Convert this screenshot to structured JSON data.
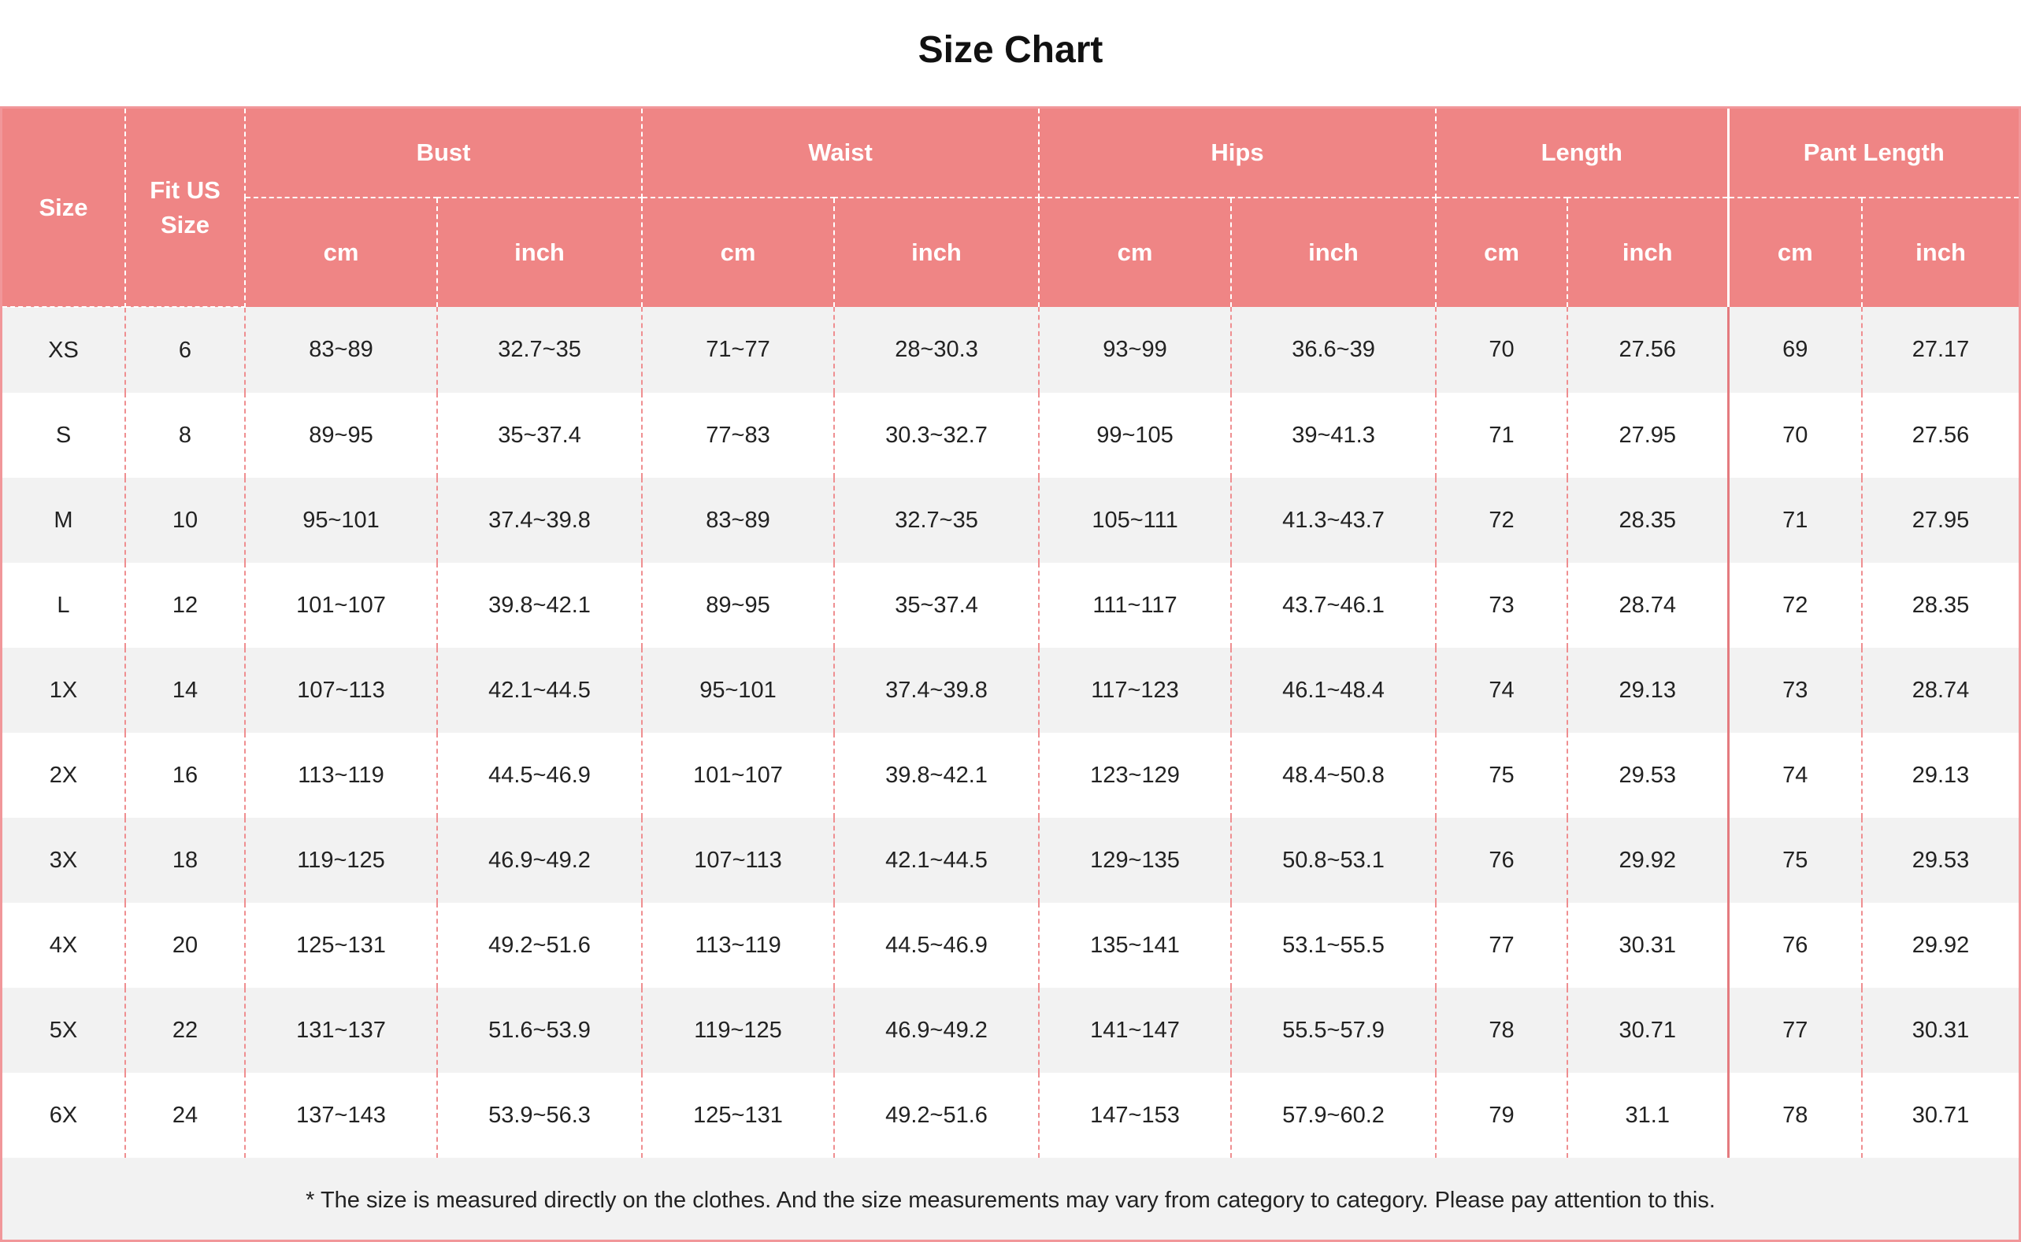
{
  "title": "Size Chart",
  "header": {
    "size": "Size",
    "fit_us_size": "Fit US Size",
    "groups": [
      "Bust",
      "Waist",
      "Hips",
      "Length",
      "Pant Length"
    ],
    "unit_cm": "cm",
    "unit_inch": "inch"
  },
  "rows": [
    [
      "XS",
      "6",
      "83~89",
      "32.7~35",
      "71~77",
      "28~30.3",
      "93~99",
      "36.6~39",
      "70",
      "27.56",
      "69",
      "27.17"
    ],
    [
      "S",
      "8",
      "89~95",
      "35~37.4",
      "77~83",
      "30.3~32.7",
      "99~105",
      "39~41.3",
      "71",
      "27.95",
      "70",
      "27.56"
    ],
    [
      "M",
      "10",
      "95~101",
      "37.4~39.8",
      "83~89",
      "32.7~35",
      "105~111",
      "41.3~43.7",
      "72",
      "28.35",
      "71",
      "27.95"
    ],
    [
      "L",
      "12",
      "101~107",
      "39.8~42.1",
      "89~95",
      "35~37.4",
      "111~117",
      "43.7~46.1",
      "73",
      "28.74",
      "72",
      "28.35"
    ],
    [
      "1X",
      "14",
      "107~113",
      "42.1~44.5",
      "95~101",
      "37.4~39.8",
      "117~123",
      "46.1~48.4",
      "74",
      "29.13",
      "73",
      "28.74"
    ],
    [
      "2X",
      "16",
      "113~119",
      "44.5~46.9",
      "101~107",
      "39.8~42.1",
      "123~129",
      "48.4~50.8",
      "75",
      "29.53",
      "74",
      "29.13"
    ],
    [
      "3X",
      "18",
      "119~125",
      "46.9~49.2",
      "107~113",
      "42.1~44.5",
      "129~135",
      "50.8~53.1",
      "76",
      "29.92",
      "75",
      "29.53"
    ],
    [
      "4X",
      "20",
      "125~131",
      "49.2~51.6",
      "113~119",
      "44.5~46.9",
      "135~141",
      "53.1~55.5",
      "77",
      "30.31",
      "76",
      "29.92"
    ],
    [
      "5X",
      "22",
      "131~137",
      "51.6~53.9",
      "119~125",
      "46.9~49.2",
      "141~147",
      "55.5~57.9",
      "78",
      "30.71",
      "77",
      "30.31"
    ],
    [
      "6X",
      "24",
      "137~143",
      "53.9~56.3",
      "125~131",
      "49.2~51.6",
      "147~153",
      "57.9~60.2",
      "79",
      "31.1",
      "78",
      "30.71"
    ]
  ],
  "note": "* The size is measured directly on the clothes. And the size measurements may vary from category to category. Please pay attention to this.",
  "colors": {
    "header_bg": "#ef8585",
    "row_alt": "#f2f2f2",
    "border": "#f1979a"
  }
}
